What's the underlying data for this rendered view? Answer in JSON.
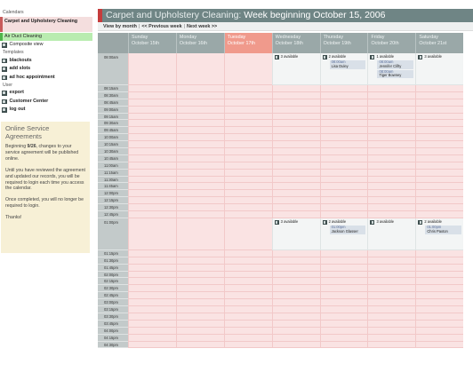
{
  "sidebar": {
    "calendars_heading": "Calendars",
    "calendars": [
      {
        "label": "Carpet and Upholstery Cleaning"
      },
      {
        "label": "Air Duct Cleaning"
      },
      {
        "label": "Composite view"
      }
    ],
    "templates_heading": "Templates",
    "templates": [
      {
        "label": "blackouts"
      },
      {
        "label": "add slots"
      },
      {
        "label": "ad hoc appointment"
      }
    ],
    "user_heading": "User",
    "user": [
      {
        "label": "export"
      },
      {
        "label": "Customer Center"
      },
      {
        "label": "log out"
      }
    ],
    "notice": {
      "title": "Online Service Agreements",
      "p1_pre": "Beginning ",
      "p1_bold": "9/26",
      "p1_post": ", changes to your service agreement will be published online.",
      "p2": "Until you have reviewed the agreement and updated our records, you will be required to login each time you access the calendar.",
      "p3": "Once completed, you will no longer be required to login.",
      "p4": "Thanks!"
    }
  },
  "header": {
    "calendar_name": "Carpet and Upholstery Cleaning:",
    "week_title": "Week beginning October 15, 2006"
  },
  "nav": {
    "view_by_month": "View by month",
    "sep": "|",
    "previous_week": "<< Previous week",
    "next_week": "Next week >>"
  },
  "days": [
    {
      "name": "Sunday",
      "date": "October 15th"
    },
    {
      "name": "Monday",
      "date": "October 16th"
    },
    {
      "name": "Tuesday",
      "date": "October 17th"
    },
    {
      "name": "Wednesday",
      "date": "October 18th"
    },
    {
      "name": "Thursday",
      "date": "October 19th"
    },
    {
      "name": "Friday",
      "date": "October 20th"
    },
    {
      "name": "Saturday",
      "date": "October 21st"
    }
  ],
  "times": [
    "08:00am",
    "08:15am",
    "08:30am",
    "08:45am",
    "09:00am",
    "09:15am",
    "09:30am",
    "09:45am",
    "10:00am",
    "10:15am",
    "10:30am",
    "10:45am",
    "11:00am",
    "11:15am",
    "11:30am",
    "11:45am",
    "12:00pm",
    "12:15pm",
    "12:30pm",
    "12:45pm",
    "01:00pm",
    "01:15pm",
    "01:30pm",
    "01:45pm",
    "02:00pm",
    "02:15pm",
    "02:30pm",
    "02:45pm",
    "03:00pm",
    "03:15pm",
    "03:30pm",
    "03:45pm",
    "04:00pm",
    "04:15pm",
    "04:30pm"
  ],
  "slots": {
    "am": {
      "wed": {
        "available": "3 available",
        "bookings": []
      },
      "thu": {
        "available": "2 available",
        "bookings": [
          {
            "time": "08:00am",
            "name": "Lisa Duley"
          }
        ]
      },
      "fri": {
        "available": "1 available",
        "bookings": [
          {
            "time": "08:00am",
            "name": "Jennifer Clifty"
          },
          {
            "time": "08:00am",
            "name": "Tiger Bowney"
          }
        ]
      },
      "sat": {
        "available": "3 available",
        "bookings": []
      }
    },
    "pm": {
      "wed": {
        "available": "3 available",
        "bookings": []
      },
      "thu": {
        "available": "2 available",
        "bookings": [
          {
            "time": "01:00pm",
            "name": "Jackson Glasser"
          }
        ]
      },
      "fri": {
        "available": "3 available",
        "bookings": []
      },
      "sat": {
        "available": "2 available",
        "bookings": [
          {
            "time": "01:00pm",
            "name": "Chris Paxton"
          }
        ]
      }
    }
  },
  "colors": {
    "header_bg": "#6f8585",
    "accent_red": "#c53c3c",
    "today_header": "#f09a8c",
    "blocked_cell": "#fae3e3",
    "available_cell": "#f3f5f5"
  }
}
